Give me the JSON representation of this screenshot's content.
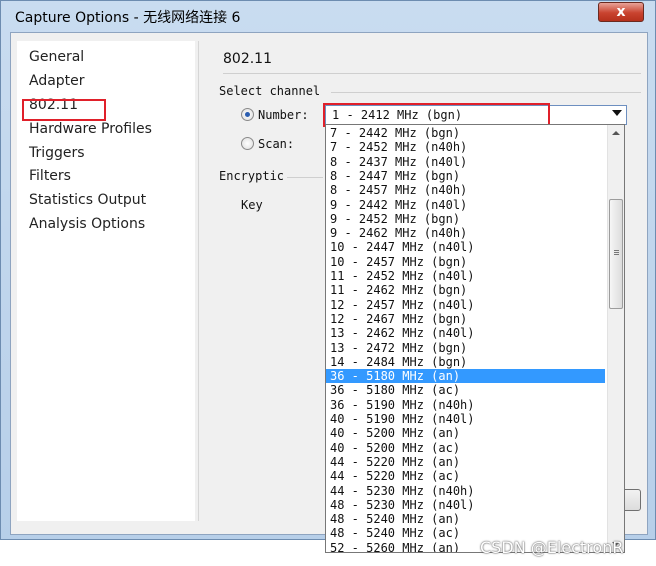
{
  "window": {
    "title": "Capture Options - 无线网络连接 6",
    "close_label": "x"
  },
  "nav": {
    "items": [
      {
        "label": "General"
      },
      {
        "label": "Adapter"
      },
      {
        "label": "802.11"
      },
      {
        "label": "Hardware Profiles"
      },
      {
        "label": "Triggers"
      },
      {
        "label": "Filters"
      },
      {
        "label": "Statistics Output"
      },
      {
        "label": "Analysis Options"
      }
    ],
    "selected": "802.11"
  },
  "panel": {
    "title": "802.11",
    "select_channel": {
      "group_label": "Select channel",
      "number_label": "Number:",
      "scan_label": "Scan:",
      "selected_mode": "number",
      "dropdown_value": "1 - 2412 MHz (bgn)"
    },
    "encryption": {
      "group_label": "Encryptic",
      "key_label": "Key"
    }
  },
  "channel_list": {
    "selected": "36 - 5180 MHz (an)",
    "items": [
      "7 - 2442 MHz (bgn)",
      "7 - 2452 MHz (n40h)",
      "8 - 2437 MHz (n40l)",
      "8 - 2447 MHz (bgn)",
      "8 - 2457 MHz (n40h)",
      "9 - 2442 MHz (n40l)",
      "9 - 2452 MHz (bgn)",
      "9 - 2462 MHz (n40h)",
      "10 - 2447 MHz (n40l)",
      "10 - 2457 MHz (bgn)",
      "11 - 2452 MHz (n40l)",
      "11 - 2462 MHz (bgn)",
      "12 - 2457 MHz (n40l)",
      "12 - 2467 MHz (bgn)",
      "13 - 2462 MHz (n40l)",
      "13 - 2472 MHz (bgn)",
      "14 - 2484 MHz (bgn)",
      "36 - 5180 MHz (an)",
      "36 - 5180 MHz (ac)",
      "36 - 5190 MHz (n40h)",
      "40 - 5190 MHz (n40l)",
      "40 - 5200 MHz (an)",
      "40 - 5200 MHz (ac)",
      "44 - 5220 MHz (an)",
      "44 - 5220 MHz (ac)",
      "44 - 5230 MHz (n40h)",
      "48 - 5230 MHz (n40l)",
      "48 - 5240 MHz (an)",
      "48 - 5240 MHz (ac)",
      "52 - 5260 MHz (an)"
    ]
  },
  "watermark": "CSDN @ElectronR",
  "colors": {
    "highlight_box": "#e0202a",
    "selection": "#3399ff"
  }
}
